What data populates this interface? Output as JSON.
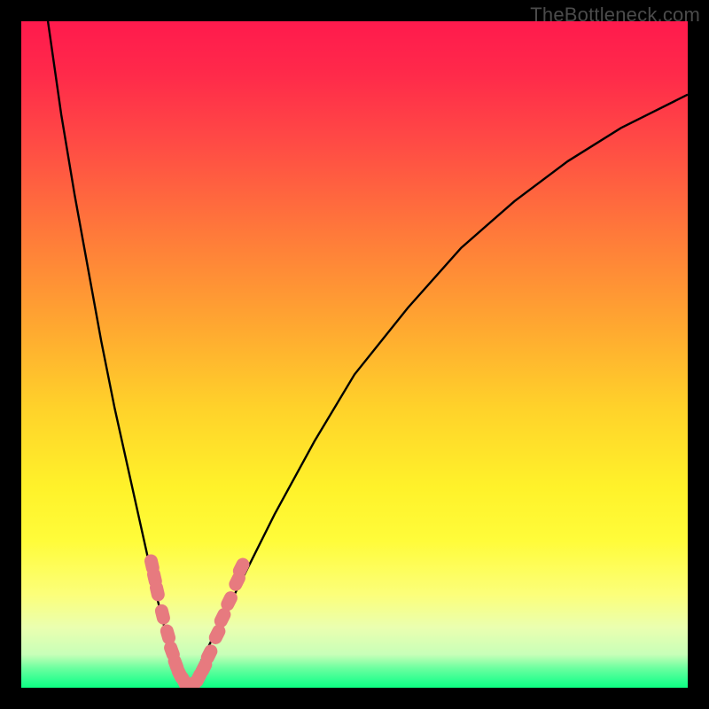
{
  "credit_text": "TheBottleneck.com",
  "colors": {
    "frame": "#000000",
    "curve": "#000000",
    "marker": "#e77a7f",
    "credit": "#4b4b4b"
  },
  "chart_data": {
    "type": "line",
    "title": "",
    "xlabel": "",
    "ylabel": "",
    "xlim": [
      0,
      100
    ],
    "ylim": [
      0,
      100
    ],
    "grid": false,
    "series": [
      {
        "name": "left-branch",
        "x": [
          4,
          6,
          8,
          10,
          12,
          14,
          16,
          18,
          20,
          21,
          22,
          23,
          24,
          25
        ],
        "y": [
          100,
          86,
          74,
          63,
          52,
          42,
          33,
          24,
          15,
          11,
          7,
          4,
          1.5,
          0
        ]
      },
      {
        "name": "right-branch",
        "x": [
          25,
          27,
          30,
          34,
          38,
          44,
          50,
          58,
          66,
          74,
          82,
          90,
          98,
          100
        ],
        "y": [
          0,
          4,
          10,
          18,
          26,
          37,
          47,
          57,
          66,
          73,
          79,
          84,
          88,
          89
        ]
      }
    ],
    "markers": [
      {
        "x": 19.6,
        "y": 18.5,
        "series": "left-branch"
      },
      {
        "x": 20.0,
        "y": 16.5,
        "series": "left-branch"
      },
      {
        "x": 20.4,
        "y": 14.5,
        "series": "left-branch"
      },
      {
        "x": 21.2,
        "y": 11.0,
        "series": "left-branch"
      },
      {
        "x": 22.0,
        "y": 8.0,
        "series": "left-branch"
      },
      {
        "x": 22.6,
        "y": 5.5,
        "series": "left-branch"
      },
      {
        "x": 23.2,
        "y": 3.5,
        "series": "left-branch"
      },
      {
        "x": 23.8,
        "y": 2.0,
        "series": "left-branch"
      },
      {
        "x": 24.4,
        "y": 1.0,
        "series": "left-branch"
      },
      {
        "x": 25.0,
        "y": 0.3,
        "series": "left-branch"
      },
      {
        "x": 25.8,
        "y": 0.3,
        "series": "right-branch"
      },
      {
        "x": 26.6,
        "y": 1.5,
        "series": "right-branch"
      },
      {
        "x": 27.4,
        "y": 3.0,
        "series": "right-branch"
      },
      {
        "x": 28.2,
        "y": 5.0,
        "series": "right-branch"
      },
      {
        "x": 29.4,
        "y": 8.0,
        "series": "right-branch"
      },
      {
        "x": 30.2,
        "y": 10.5,
        "series": "right-branch"
      },
      {
        "x": 31.2,
        "y": 13.0,
        "series": "right-branch"
      },
      {
        "x": 32.4,
        "y": 16.0,
        "series": "right-branch"
      },
      {
        "x": 33.0,
        "y": 18.0,
        "series": "right-branch"
      }
    ]
  }
}
